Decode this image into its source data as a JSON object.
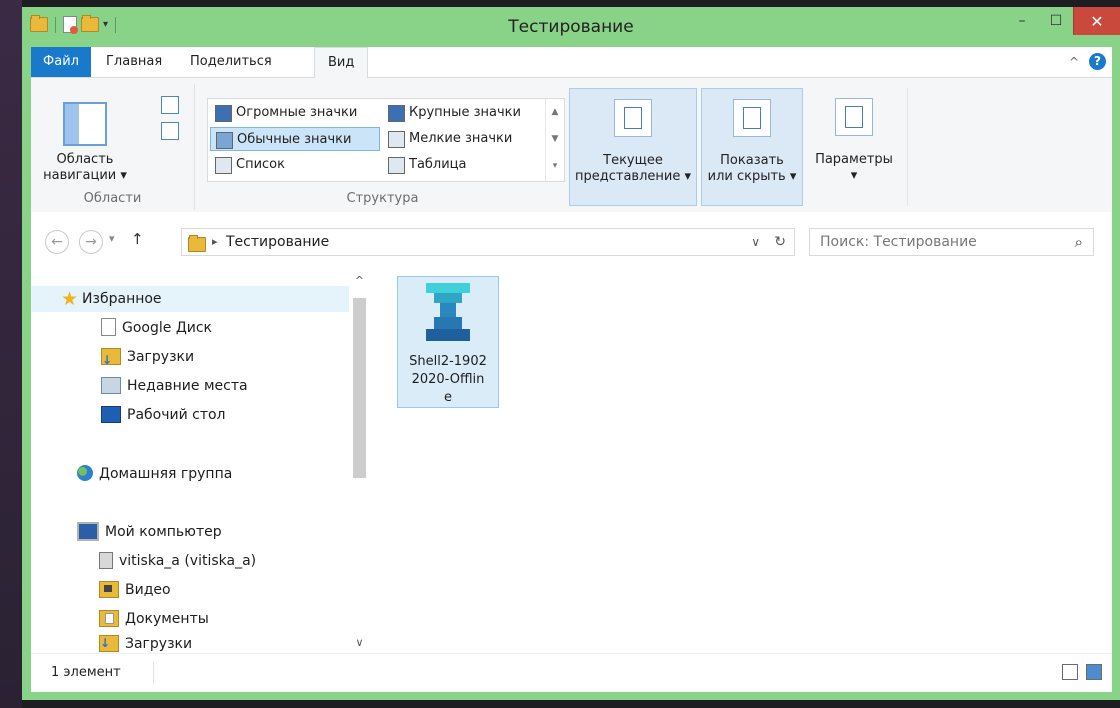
{
  "window": {
    "title": "Тестирование"
  },
  "titlebar": {
    "minimize": "–",
    "maximize": "☐",
    "close": "✕",
    "qat_arrow": "▾"
  },
  "tabs": [
    {
      "label": "Файл"
    },
    {
      "label": "Главная"
    },
    {
      "label": "Поделиться"
    },
    {
      "label": "Вид"
    }
  ],
  "ribbon_right": {
    "collapse": "^",
    "help": "?"
  },
  "ribbon": {
    "areas": {
      "nav_pane_line1": "Область",
      "nav_pane_line2": "навигации ▾",
      "label": "Области"
    },
    "structure": {
      "label": "Структура",
      "items": [
        "Огромные значки",
        "Крупные значки",
        "Обычные значки",
        "Мелкие значки",
        "Список",
        "Таблица"
      ],
      "scroll_up": "▲",
      "scroll_down": "▼",
      "scroll_more": "▾"
    },
    "current_view_line1": "Текущее",
    "current_view_line2": "представление ▾",
    "show_hide_line1": "Показать",
    "show_hide_line2": "или скрыть ▾",
    "options_line1": "Параметры",
    "options_line2": "▾"
  },
  "address": {
    "back": "←",
    "forward": "→",
    "recent": "▾",
    "up": "↑",
    "separator": "▸",
    "path": "Тестирование",
    "dropdown": "∨",
    "refresh": "↻",
    "search_placeholder": "Поиск: Тестирование",
    "search_icon": "⌕"
  },
  "tree": {
    "favorites": "Избранное",
    "google_drive": "Google Диск",
    "downloads": "Загрузки",
    "recent_places": "Недавние места",
    "desktop": "Рабочий стол",
    "homegroup": "Домашняя группа",
    "my_computer": "Мой компьютер",
    "network_drive": "vitiska_a (vitiska_a)",
    "video": "Видео",
    "documents": "Документы",
    "downloads2": "Загрузки"
  },
  "scroll": {
    "up": "^",
    "down": "∨"
  },
  "files": [
    {
      "name_line1": "Shell2-1902",
      "name_line2": "2020-Offlin",
      "name_line3": "e"
    }
  ],
  "status": {
    "count": "1 элемент"
  },
  "colors": {
    "window_border": "#89d389",
    "accent": "#1979ca",
    "close": "#c94a3c"
  }
}
